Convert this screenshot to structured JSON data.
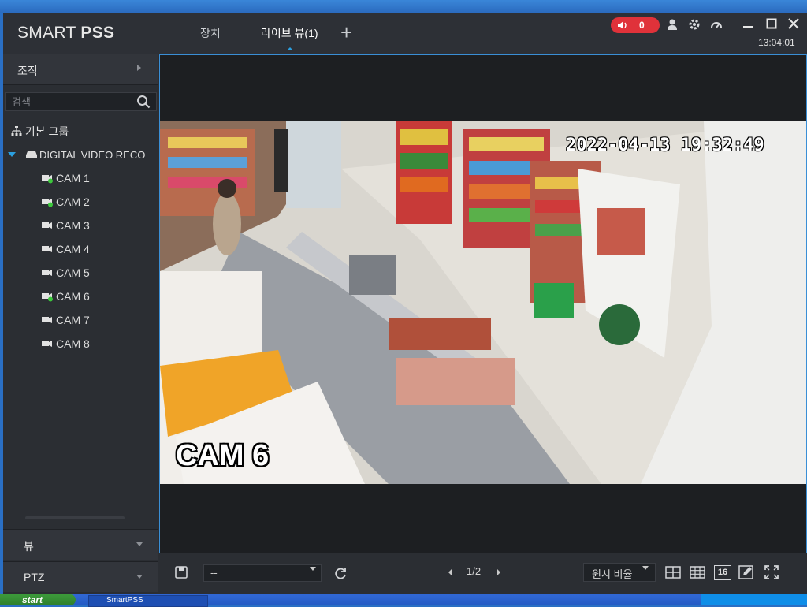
{
  "app": {
    "logo_light": "SMART ",
    "logo_bold": "PSS"
  },
  "tabs": [
    {
      "label": "장치"
    },
    {
      "label": "라이브 뷰(1)"
    }
  ],
  "titlebar": {
    "alarm_count": "0",
    "clock": "13:04:01"
  },
  "sidebar": {
    "org_label": "조직",
    "search_placeholder": "검색",
    "root_group": "기본 그룹",
    "device_name": "DIGITAL VIDEO RECO",
    "cameras": [
      {
        "label": "CAM 1",
        "online": true
      },
      {
        "label": "CAM 2",
        "online": true
      },
      {
        "label": "CAM 3",
        "online": false
      },
      {
        "label": "CAM 4",
        "online": false
      },
      {
        "label": "CAM 5",
        "online": false
      },
      {
        "label": "CAM 6",
        "online": true
      },
      {
        "label": "CAM 7",
        "online": false
      },
      {
        "label": "CAM 8",
        "online": false
      }
    ],
    "view_section": "뷰",
    "ptz_section": "PTZ"
  },
  "video": {
    "osd_time": "2022-04-13 19:32:49",
    "osd_cam": "CAM 6"
  },
  "bottombar": {
    "stream_value": "--",
    "page": "1/2",
    "ratio": "원시 비율",
    "layout_16": "16"
  },
  "taskbar": {
    "start": "start",
    "task_label": "SmartPSS"
  },
  "colors": {
    "accent": "#2b9fe0",
    "online": "#3cc83c",
    "alarm": "#e0323a"
  }
}
